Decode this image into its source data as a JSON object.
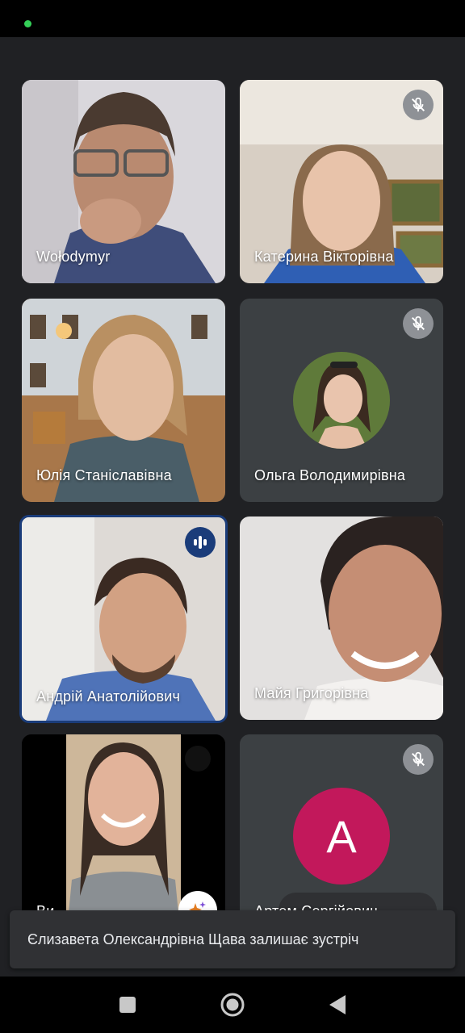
{
  "participants": [
    {
      "name": "Wołodymyr",
      "muted": false
    },
    {
      "name": "Катерина Вікторівна",
      "muted": true
    },
    {
      "name": "Юлія Станіславівна",
      "muted": false
    },
    {
      "name": "Ольга Володимирівна",
      "muted": true
    },
    {
      "name": "Андрій Анатолійович",
      "muted": false,
      "speaking": true
    },
    {
      "name": "Майя Григорівна",
      "muted": false
    },
    {
      "name": "Ви",
      "muted": false
    },
    {
      "name": "Артем Сергійович",
      "muted": true,
      "avatar_letter": "A",
      "avatar_color": "#c2185b"
    }
  ],
  "toast": {
    "text": "Єлизавета Олександрівна Щава залишає зустріч"
  },
  "colors": {
    "background": "#202124",
    "speaking_border": "#1a3c7a",
    "status_dot": "#34d058"
  }
}
